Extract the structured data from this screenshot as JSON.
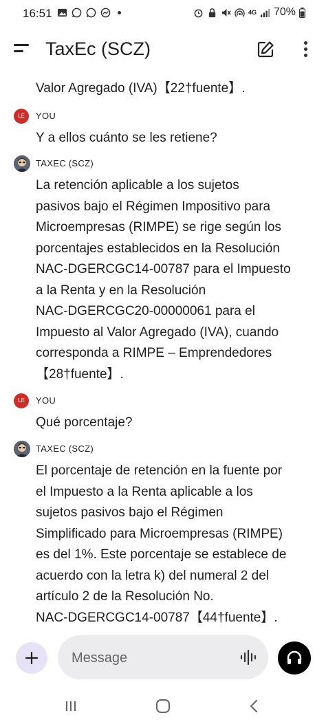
{
  "status_bar": {
    "time": "16:51",
    "battery": "70%",
    "network": "4G"
  },
  "app_bar": {
    "title": "TaxEc (SCZ)"
  },
  "chat": {
    "partial_text": "Valor Agregado (IVA)【22†fuente】.",
    "messages": [
      {
        "sender": "YOU",
        "avatar": "LE",
        "text": "Y a ellos cuánto se les retiene?"
      },
      {
        "sender": "TAXEC (SCZ)",
        "text": "La retención aplicable a los sujetos\npasivos bajo el Régimen Impositivo para\nMicroempresas (RIMPE) se rige según los\nporcentajes establecidos en la Resolución\nNAC-DGERCGC14-00787 para el Impuesto\na la Renta y en la Resolución\nNAC-DGERCGC20-00000061 para el\nImpuesto al Valor Agregado (IVA), cuando\ncorresponda a RIMPE – Emprendedores\n【28†fuente】."
      },
      {
        "sender": "YOU",
        "avatar": "LE",
        "text": "Qué porcentaje?"
      },
      {
        "sender": "TAXEC (SCZ)",
        "text": "El porcentaje de retención en la fuente por\nel Impuesto a la Renta aplicable a los\nsujetos pasivos bajo el Régimen\nSimplificado para Microempresas (RIMPE)\nes del 1%. Este porcentaje se establece de\nacuerdo con la letra k) del numeral 2 del\nartículo 2 de la Resolución No.\nNAC-DGERCGC14-00787【44†fuente】."
      }
    ]
  },
  "composer": {
    "placeholder": "Message",
    "value": ""
  },
  "colors": {
    "user_avatar": "#c9302c",
    "plus_button_bg": "#e7e2f6",
    "input_bg": "#ececef",
    "headset_button_bg": "#000000"
  },
  "icons": [
    "menu-icon",
    "edit-icon",
    "more-vert-icon",
    "plus-icon",
    "voice-waveform-icon",
    "headset-icon",
    "recents-icon",
    "home-icon",
    "back-icon"
  ]
}
